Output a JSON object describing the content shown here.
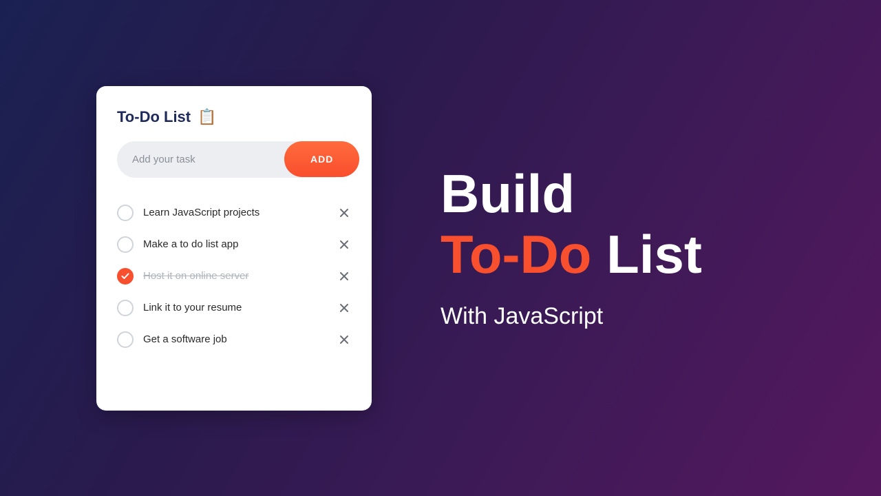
{
  "card": {
    "title": "To-Do List",
    "icon": "📋",
    "input_placeholder": "Add your task",
    "add_button": "ADD",
    "items": [
      {
        "text": "Learn JavaScript projects",
        "done": false
      },
      {
        "text": "Make a to do list app",
        "done": false
      },
      {
        "text": "Host it on online server",
        "done": true
      },
      {
        "text": "Link it to your resume",
        "done": false
      },
      {
        "text": "Get a software job",
        "done": false
      }
    ]
  },
  "hero": {
    "line1": "Build",
    "line2_accent": "To-Do",
    "line2_rest": " List",
    "subtitle": "With JavaScript"
  },
  "colors": {
    "accent": "#f84f2e",
    "title": "#1e2a5a"
  }
}
